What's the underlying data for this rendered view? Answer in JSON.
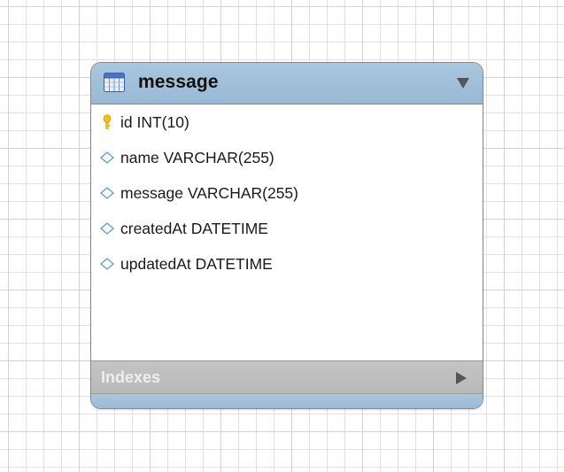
{
  "entity": {
    "name": "message",
    "icon": "table-icon",
    "header_color": "#9dbdd8",
    "columns": [
      {
        "text": "id INT(10)",
        "icon": "primary-key-icon",
        "key_color": "#f2c21b"
      },
      {
        "text": "name VARCHAR(255)",
        "icon": "column-diamond-icon"
      },
      {
        "text": "message VARCHAR(255)",
        "icon": "column-diamond-icon"
      },
      {
        "text": "createdAt DATETIME",
        "icon": "column-diamond-icon"
      },
      {
        "text": "updatedAt DATETIME",
        "icon": "column-diamond-icon"
      }
    ],
    "indexes_label": "Indexes",
    "indexes_bar_color": "#bdbdbd"
  }
}
